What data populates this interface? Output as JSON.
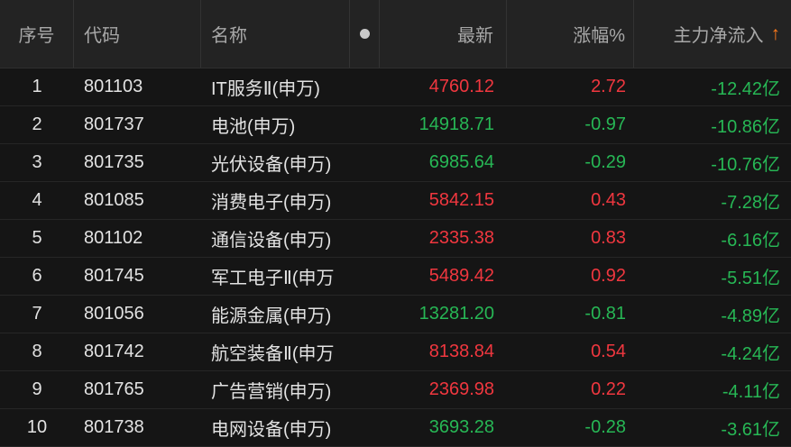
{
  "colors": {
    "up": "#f0373f",
    "down": "#27b755",
    "sort_arrow": "#ff7a1a"
  },
  "header": {
    "index": "序号",
    "code": "代码",
    "name": "名称",
    "latest": "最新",
    "change_pct": "涨幅%",
    "main_net_inflow": "主力净流入",
    "sort_arrow": "↑",
    "dot_icon": "dot-icon"
  },
  "rows": [
    {
      "index": "1",
      "code": "801103",
      "name": "IT服务Ⅱ(申万)",
      "latest": "4760.12",
      "change": "2.72",
      "flow": "-12.42亿",
      "trend": "up"
    },
    {
      "index": "2",
      "code": "801737",
      "name": "电池(申万)",
      "latest": "14918.71",
      "change": "-0.97",
      "flow": "-10.86亿",
      "trend": "down"
    },
    {
      "index": "3",
      "code": "801735",
      "name": "光伏设备(申万)",
      "latest": "6985.64",
      "change": "-0.29",
      "flow": "-10.76亿",
      "trend": "down"
    },
    {
      "index": "4",
      "code": "801085",
      "name": "消费电子(申万)",
      "latest": "5842.15",
      "change": "0.43",
      "flow": "-7.28亿",
      "trend": "up"
    },
    {
      "index": "5",
      "code": "801102",
      "name": "通信设备(申万)",
      "latest": "2335.38",
      "change": "0.83",
      "flow": "-6.16亿",
      "trend": "up"
    },
    {
      "index": "6",
      "code": "801745",
      "name": "军工电子Ⅱ(申万",
      "latest": "5489.42",
      "change": "0.92",
      "flow": "-5.51亿",
      "trend": "up"
    },
    {
      "index": "7",
      "code": "801056",
      "name": "能源金属(申万)",
      "latest": "13281.20",
      "change": "-0.81",
      "flow": "-4.89亿",
      "trend": "down"
    },
    {
      "index": "8",
      "code": "801742",
      "name": "航空装备Ⅱ(申万",
      "latest": "8138.84",
      "change": "0.54",
      "flow": "-4.24亿",
      "trend": "up"
    },
    {
      "index": "9",
      "code": "801765",
      "name": "广告营销(申万)",
      "latest": "2369.98",
      "change": "0.22",
      "flow": "-4.11亿",
      "trend": "up"
    },
    {
      "index": "10",
      "code": "801738",
      "name": "电网设备(申万)",
      "latest": "3693.28",
      "change": "-0.28",
      "flow": "-3.61亿",
      "trend": "down"
    }
  ]
}
